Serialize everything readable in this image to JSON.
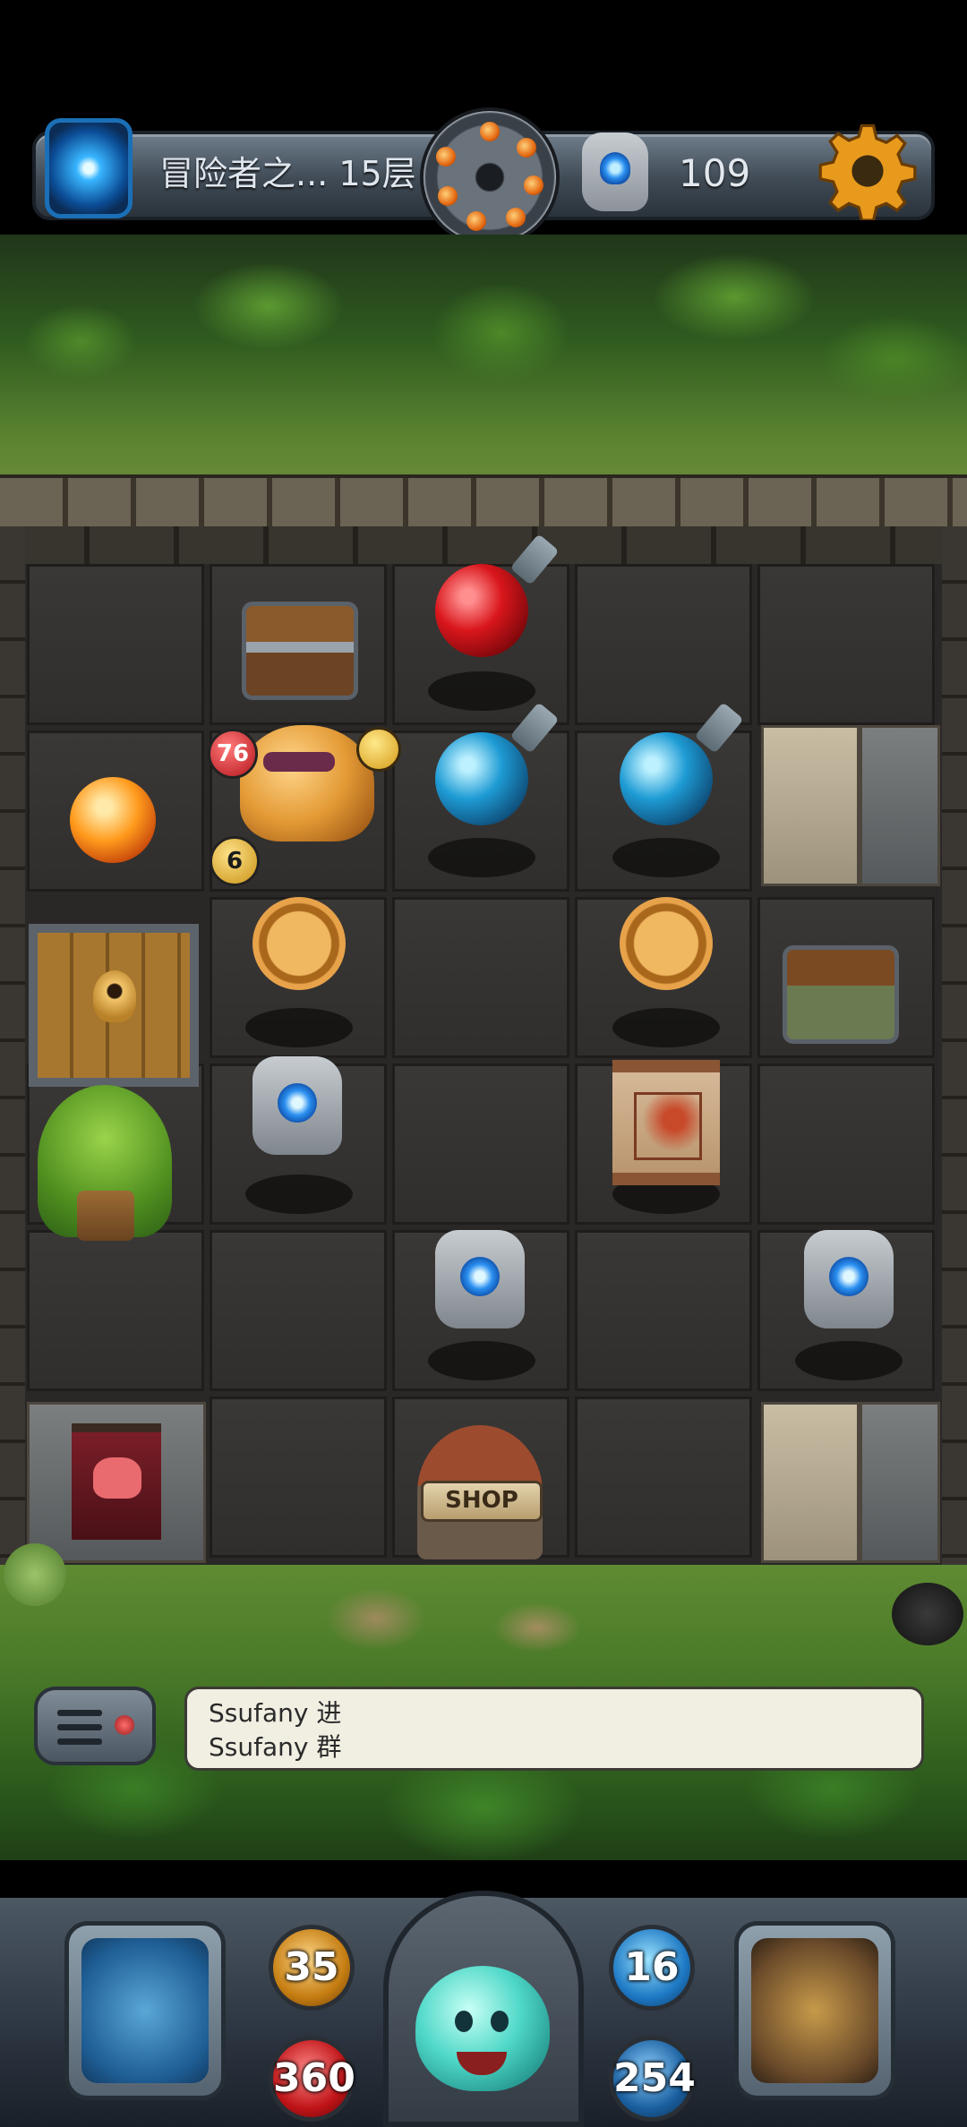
{
  "header": {
    "level_title": "冒险者之... 15层",
    "rune_count": "109"
  },
  "board": {
    "monster_hp": "76",
    "monster_attack": "6",
    "shop_sign": "SHOP"
  },
  "chat": {
    "lines": [
      "Ssufany 进",
      "Ssufany 群"
    ]
  },
  "stats": {
    "attack": "35",
    "hp": "360",
    "defense": "16",
    "mana": "254"
  },
  "colors": {
    "hp_red": "#c01418",
    "attack_gold": "#c57d12",
    "defense_blue": "#1e79c4",
    "jungle_green": "#4a7a28"
  }
}
